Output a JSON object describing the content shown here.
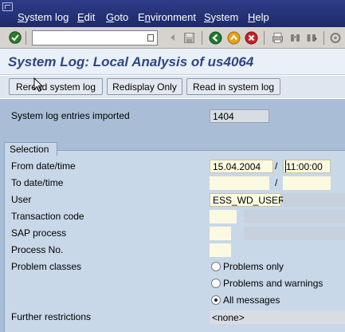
{
  "menu": {
    "items": [
      {
        "pre": "",
        "u": "S",
        "post": "ystem log"
      },
      {
        "pre": "",
        "u": "E",
        "post": "dit"
      },
      {
        "pre": "",
        "u": "G",
        "post": "oto"
      },
      {
        "pre": "E",
        "u": "n",
        "post": "vironment"
      },
      {
        "pre": "",
        "u": "S",
        "post": "ystem"
      },
      {
        "pre": "",
        "u": "H",
        "post": "elp"
      }
    ]
  },
  "toolbar": {
    "command_field_value": ""
  },
  "title": "System Log: Local Analysis of us4064",
  "app_buttons": {
    "reread": "Reread system log",
    "redisplay": "Redisplay Only",
    "read_in": "Read in system log"
  },
  "imported": {
    "label": "System log entries imported",
    "value": "1404"
  },
  "selection": {
    "tab_label": "Selection",
    "from_label": "From date/time",
    "from_date": "15.04.2004",
    "from_sep": "/",
    "from_time": "11:00:00",
    "to_label": "To date/time",
    "to_sep": "/",
    "user_label": "User",
    "user_value": "ESS_WD_USER1",
    "tcode_label": "Transaction code",
    "sap_process_label": "SAP process",
    "process_no_label": "Process No.",
    "problem_classes_label": "Problem classes",
    "radio_problems_only": "Problems only",
    "radio_problems_warnings": "Problems and warnings",
    "radio_all": "All messages",
    "further_label": "Further restrictions",
    "further_value": "<none>"
  },
  "colors": {
    "menubar": "#1d2a6a",
    "title_text": "#2f4682",
    "content_bg": "#a9bed6"
  }
}
